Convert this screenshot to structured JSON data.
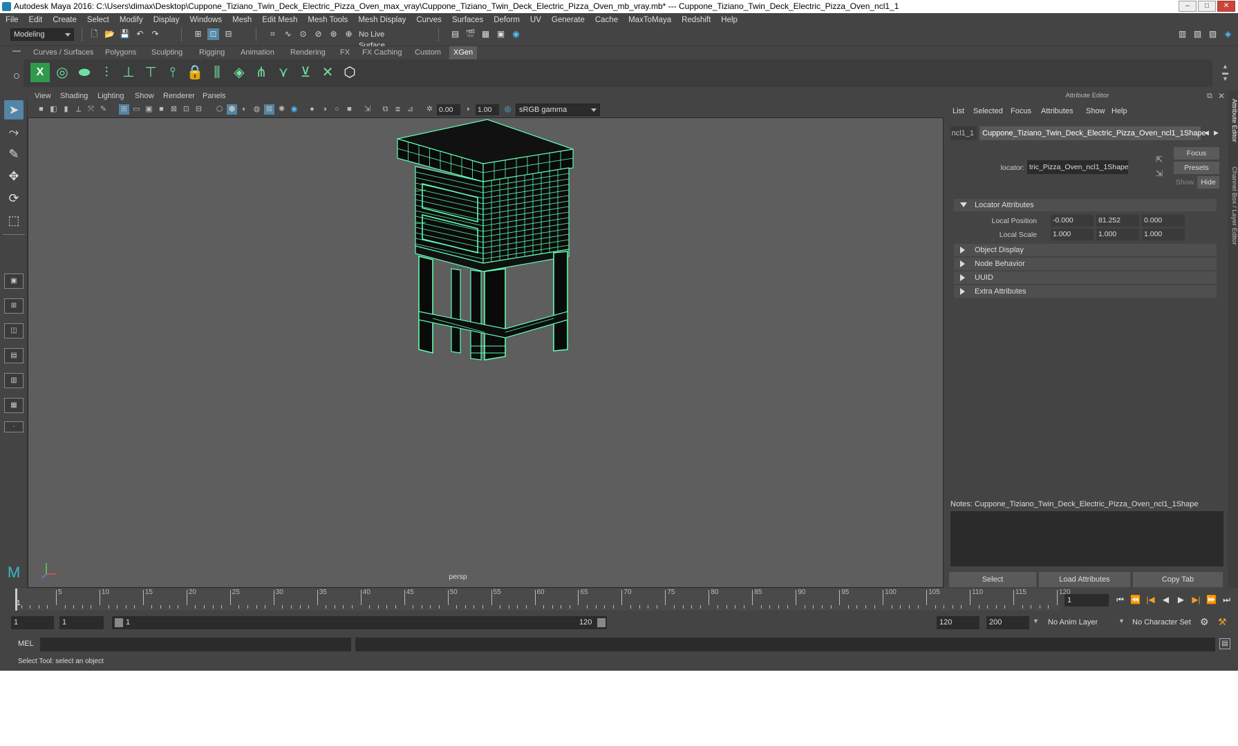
{
  "window": {
    "title": "Autodesk Maya 2016: C:\\Users\\dimax\\Desktop\\Cuppone_Tiziano_Twin_Deck_Electric_Pizza_Oven_max_vray\\Cuppone_Tiziano_Twin_Deck_Electric_Pizza_Oven_mb_vray.mb*   ---   Cuppone_Tiziano_Twin_Deck_Electric_Pizza_Oven_ncl1_1"
  },
  "menubar": [
    "File",
    "Edit",
    "Create",
    "Select",
    "Modify",
    "Display",
    "Windows",
    "Mesh",
    "Edit Mesh",
    "Mesh Tools",
    "Mesh Display",
    "Curves",
    "Surfaces",
    "Deform",
    "UV",
    "Generate",
    "Cache",
    "MaxToMaya",
    "Redshift",
    "Help"
  ],
  "statusline": {
    "mode": "Modeling",
    "live_surface": "No Live Surface"
  },
  "shelf_tabs": [
    "Curves / Surfaces",
    "Polygons",
    "Sculpting",
    "Rigging",
    "Animation",
    "Rendering",
    "FX",
    "FX Caching",
    "Custom",
    "XGen"
  ],
  "shelf_active": "XGen",
  "viewport": {
    "menu": [
      "View",
      "Shading",
      "Lighting",
      "Show",
      "Renderer",
      "Panels"
    ],
    "exposure": "0.00",
    "gamma": "1.00",
    "color_space": "sRGB gamma",
    "camera_label": "persp",
    "wire_color": "#5dffb0"
  },
  "attribute_editor": {
    "title": "Attribute Editor",
    "menu": [
      "List",
      "Selected",
      "Focus",
      "Attributes",
      "Show",
      "Help"
    ],
    "tabs": [
      "ncl1_1",
      "Cuppone_Tiziano_Twin_Deck_Electric_Pizza_Oven_ncl1_1Shape"
    ],
    "locator_label": "locator:",
    "locator_value": "tric_Pizza_Oven_ncl1_1Shape",
    "focus_btn": "Focus",
    "presets_btn": "Presets",
    "show_btn": "Show",
    "hide_btn": "Hide",
    "sections": {
      "locator": "Locator Attributes",
      "object_display": "Object Display",
      "node_behavior": "Node Behavior",
      "uuid": "UUID",
      "extra": "Extra Attributes"
    },
    "local_position_label": "Local Position",
    "local_position": [
      "-0.000",
      "81.252",
      "0.000"
    ],
    "local_scale_label": "Local Scale",
    "local_scale": [
      "1.000",
      "1.000",
      "1.000"
    ],
    "notes": "Notes:  Cuppone_Tiziano_Twin_Deck_Electric_Pizza_Oven_ncl1_1Shape",
    "buttons": [
      "Select",
      "Load Attributes",
      "Copy Tab"
    ]
  },
  "side_tabs": [
    "Attribute Editor",
    "Channel Box / Layer Editor"
  ],
  "timeline": {
    "ticks": [
      "5",
      "10",
      "15",
      "20",
      "25",
      "30",
      "35",
      "40",
      "45",
      "50",
      "55",
      "60",
      "65",
      "70",
      "75",
      "80",
      "85",
      "90",
      "95",
      "100",
      "105",
      "110",
      "115",
      "120"
    ],
    "first_frame": "1",
    "current_frame": "1"
  },
  "range": {
    "start": "1",
    "start2": "1",
    "slider_start": "1",
    "slider_end": "120",
    "end": "120",
    "end2": "200",
    "anim_layer": "No Anim Layer",
    "char_set": "No Character Set"
  },
  "cmd": {
    "lang": "MEL"
  },
  "helpline": "Select Tool: select an object"
}
